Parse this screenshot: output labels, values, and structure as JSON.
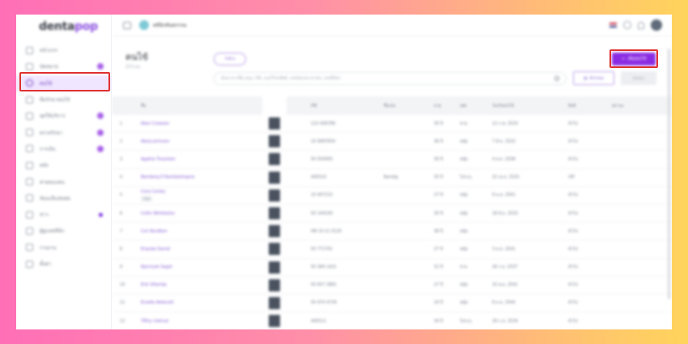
{
  "brand": {
    "name_a": "denta",
    "name_b": "pop",
    "accent": "#8a2be2"
  },
  "sidebar": {
    "items": [
      {
        "label": "หน้าแรก",
        "icon": "home-icon",
        "badge": false,
        "dot": false,
        "active": false
      },
      {
        "label": "นัดหมาย",
        "icon": "calendar-icon",
        "badge": true,
        "dot": false,
        "active": false
      },
      {
        "label": "คนไข้",
        "icon": "user-icon",
        "badge": false,
        "dot": false,
        "active": true
      },
      {
        "label": "ทีมรักษาคนไข้",
        "icon": "users-icon",
        "badge": false,
        "dot": false,
        "active": false
      },
      {
        "label": "จุดให้บริการ",
        "icon": "inbox-icon",
        "badge": true,
        "dot": false,
        "active": false
      },
      {
        "label": "ตรวจรักษา",
        "icon": "chat-icon",
        "badge": true,
        "dot": false,
        "active": false
      },
      {
        "label": "การเงิน",
        "icon": "upload-icon",
        "badge": true,
        "dot": false,
        "active": false
      },
      {
        "label": "คลัง",
        "icon": "box-icon",
        "badge": false,
        "dot": false,
        "active": false
      },
      {
        "label": "ค่าตอบแทน",
        "icon": "money-icon",
        "badge": false,
        "dot": false,
        "active": false
      },
      {
        "label": "ห้องแล็บ/ส่งต่อ",
        "icon": "lab-icon",
        "badge": false,
        "dot": false,
        "active": false
      },
      {
        "label": "ข่าว",
        "icon": "megaphone-icon",
        "badge": false,
        "dot": true,
        "active": false
      },
      {
        "label": "ผู้ดูแลคลินิก",
        "icon": "doc-icon",
        "badge": false,
        "dot": false,
        "active": false
      },
      {
        "label": "รายงาน",
        "icon": "chart-icon",
        "badge": false,
        "dot": false,
        "active": false
      },
      {
        "label": "ตั้งค่า",
        "icon": "gear-icon",
        "badge": false,
        "dot": false,
        "active": false
      }
    ]
  },
  "topbar": {
    "clinic_name": "คลินิกทันตกรรม",
    "clinic_color": "#7ec9d6"
  },
  "page": {
    "title": "คนไข้",
    "count": "373 คน",
    "reset_label": "ล้าง",
    "search_placeholder": "ค้นหาจากชื่อ-สกุล, HN, เบอร์โทรศัพท์, เลขบัตรประชาชน, เลขที่บัตร",
    "filter_label": "ตัวกรอง",
    "export_label": "ส่งออก",
    "add_label": "เพิ่มคนไข้"
  },
  "table": {
    "headers": {
      "name": "ชื่อ",
      "hn": "HN",
      "nick": "ชื่อเล่น",
      "age": "อายุ",
      "sex": "เพศ",
      "bday": "วันเกิดคนไข้",
      "right": "สิทธิ",
      "ward": "สถานะ"
    },
    "rows": [
      {
        "no": "1",
        "name": "Alexi Crowson",
        "tag": "",
        "hn": "123 456789",
        "nick": "",
        "age": "35 ปี",
        "sex": "ชาย",
        "bday": "12 ก.พ. 2533",
        "right": "ทั่วไป"
      },
      {
        "no": "2",
        "name": "Alexa Jorinson",
        "tag": "",
        "hn": "10 9087654",
        "nick": "",
        "age": "36 ปี",
        "sex": "หญิง",
        "bday": "7 มี.ค. 2532",
        "right": "ทั่วไป"
      },
      {
        "no": "3",
        "name": "Agatha Trautsten",
        "tag": "",
        "hn": "50 554093",
        "nick": "",
        "age": "30 ปี",
        "sex": "หญิง",
        "bday": "4 ส.ค. 2538",
        "right": "ทั่วไป"
      },
      {
        "no": "4",
        "name": "Bamberg E Rambleshopne",
        "tag": "",
        "hn": "445510",
        "nick": "Bambg",
        "age": "35 ปี",
        "sex": "ไม่ระบุ",
        "bday": "22 เม.ย. 2533",
        "right": "VIP"
      },
      {
        "no": "5",
        "name": "Cora Conley",
        "tag": "new",
        "hn": "10 407215",
        "nick": "",
        "age": "27 ปี",
        "sex": "หญิง",
        "bday": "9 ม.ค. 2541",
        "right": "ทั่วไป"
      },
      {
        "no": "6",
        "name": "Collin Wintleston",
        "tag": "",
        "hn": "50 144193",
        "nick": "",
        "age": "35 ปี",
        "sex": "หญิง",
        "bday": "18 มิ.ย. 2533",
        "right": "ทั่วไป"
      },
      {
        "no": "7",
        "name": "Cori Burdbon",
        "tag": "",
        "hn": "HN 10-11 0120",
        "nick": "",
        "age": "38 ปี",
        "sex": "หญิง",
        "bday": "",
        "right": "ทั่วไป"
      },
      {
        "no": "8",
        "name": "Eraylae Daniel",
        "tag": "",
        "hn": "50 771701",
        "nick": "",
        "age": "27 ปี",
        "sex": "หญิง",
        "bday": "3 ต.ค. 2541",
        "right": "ทั่วไป"
      },
      {
        "no": "9",
        "name": "Epicmyle Sagot",
        "tag": "",
        "hn": "50 384 1421",
        "nick": "",
        "age": "31 ปี",
        "sex": "ชาย",
        "bday": "26 ก.ย. 2537",
        "right": "ทั่วไป"
      },
      {
        "no": "10",
        "name": "Erik Villarrep",
        "tag": "",
        "hn": "50 657 2881",
        "nick": "",
        "age": "27 ปี",
        "sex": "หญิง",
        "bday": "15 พ.ย. 2541",
        "right": "ทั่วไป"
      },
      {
        "no": "11",
        "name": "Eryelle Adsecott",
        "tag": "",
        "hn": "50 474 4739",
        "nick": "",
        "age": "24 ปี",
        "sex": "หญิง",
        "bday": "8 ธ.ค. 2544",
        "right": "ทั่วไป"
      },
      {
        "no": "12",
        "name": "Tiffny metrud",
        "tag": "",
        "hn": "445511",
        "nick": "",
        "age": "34 ปี",
        "sex": "ไม่ระบุ",
        "bday": "29 ก.ค. 2534",
        "right": "ทั่วไป"
      }
    ]
  }
}
